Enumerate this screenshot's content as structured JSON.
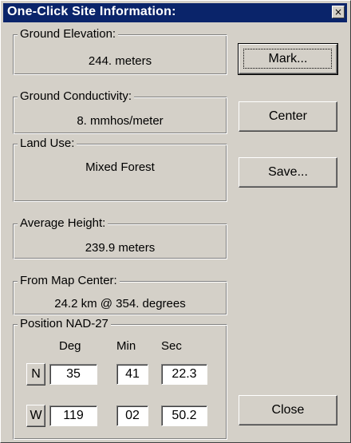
{
  "window": {
    "title": "One-Click Site Information:",
    "close_glyph": "×"
  },
  "ground_elevation": {
    "label": "Ground Elevation:",
    "value": "244. meters"
  },
  "ground_conductivity": {
    "label": "Ground Conductivity:",
    "value": "8. mmhos/meter"
  },
  "land_use": {
    "label": "Land Use:",
    "value": "Mixed Forest"
  },
  "average_height": {
    "label": "Average Height:",
    "value": "239.9 meters"
  },
  "from_map_center": {
    "label": "From Map Center:",
    "value": "24.2 km @ 354. degrees"
  },
  "position": {
    "label": "Position NAD-27",
    "headers": {
      "deg": "Deg",
      "min": "Min",
      "sec": "Sec"
    },
    "lat": {
      "hemisphere": "N",
      "deg": "35",
      "min": "41",
      "sec": "22.3"
    },
    "lon": {
      "hemisphere": "W",
      "deg": "119",
      "min": "02",
      "sec": "50.2"
    }
  },
  "buttons": {
    "mark": "Mark...",
    "center": "Center",
    "save": "Save...",
    "close": "Close"
  },
  "colors": {
    "dialog_bg": "#d4d0c8",
    "titlebar": "#0a246a",
    "title_text": "#ffffff",
    "field_bg": "#ffffff"
  }
}
